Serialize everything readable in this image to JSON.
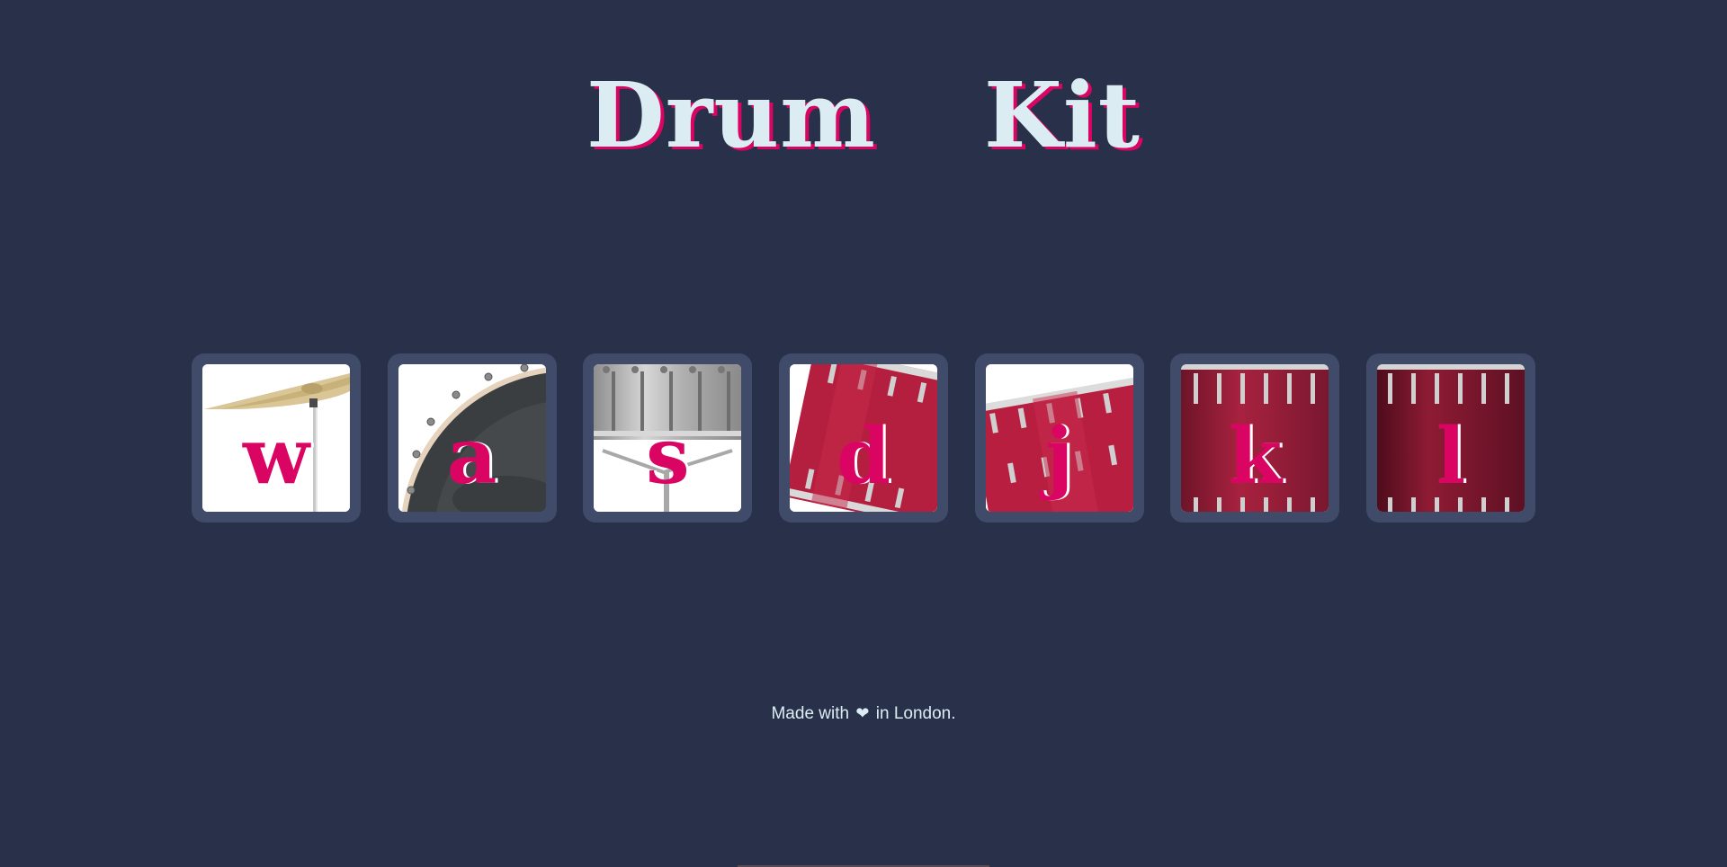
{
  "header": {
    "title_word1": "Drum",
    "title_word2": "Kit"
  },
  "drums": [
    {
      "key": "w",
      "instrument": "crash-cymbal-icon"
    },
    {
      "key": "a",
      "instrument": "kick-drum-icon"
    },
    {
      "key": "s",
      "instrument": "snare-drum-icon"
    },
    {
      "key": "d",
      "instrument": "tom-1-icon"
    },
    {
      "key": "j",
      "instrument": "tom-2-icon"
    },
    {
      "key": "k",
      "instrument": "tom-3-icon"
    },
    {
      "key": "l",
      "instrument": "tom-4-icon"
    }
  ],
  "footer": {
    "text_before": "Made with",
    "heart": "❤",
    "text_after": "in London."
  },
  "colors": {
    "background": "#283149",
    "button_frame": "#404b69",
    "accent": "#da0463",
    "text": "#dbedf3"
  }
}
